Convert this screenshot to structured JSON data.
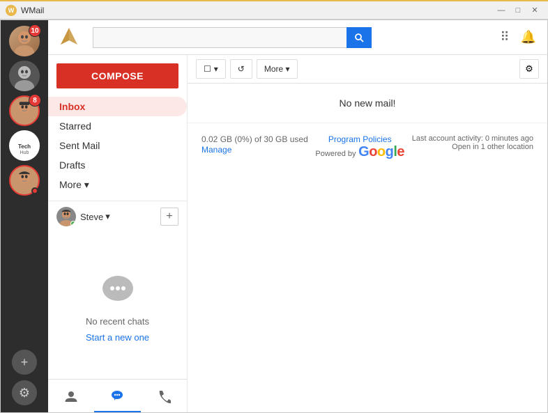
{
  "titlebar": {
    "title": "WMail",
    "icon": "W",
    "minimize": "—",
    "maximize": "□",
    "close": "✕"
  },
  "header": {
    "search_placeholder": "",
    "search_icon": "🔍"
  },
  "sidebar": {
    "compose_label": "COMPOSE",
    "nav_items": [
      {
        "label": "Inbox",
        "active": true
      },
      {
        "label": "Starred"
      },
      {
        "label": "Sent Mail"
      },
      {
        "label": "Drafts"
      },
      {
        "label": "More ▾"
      }
    ],
    "chat_user": "Steve",
    "chat_no_recent": "No recent chats",
    "chat_start": "Start a new one"
  },
  "toolbar": {
    "more_label": "More ▾",
    "refresh_icon": "↺"
  },
  "mail": {
    "status": "No new mail!",
    "storage_text": "0.02 GB (0%) of 30 GB used",
    "manage_label": "Manage",
    "policies_label": "Program Policies",
    "powered_by": "Powered by",
    "account_activity": "Last account activity: 0 minutes ago",
    "open_info": "Open in 1 other location"
  },
  "avatars": [
    {
      "badge": "10",
      "color": "#c8956c"
    },
    {
      "badge": "",
      "color": "#888"
    },
    {
      "badge": "8",
      "color": "#c8956c"
    },
    {
      "badge": "",
      "color": "#fff",
      "special": "techhub"
    },
    {
      "badge": "",
      "color": "#c8956c",
      "dot": true
    }
  ]
}
